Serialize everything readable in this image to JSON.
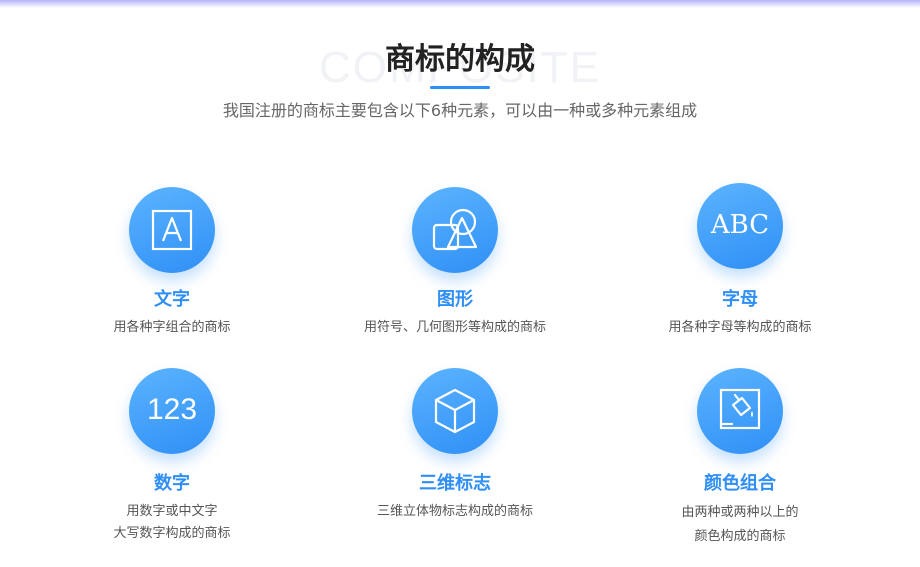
{
  "header": {
    "background_word": "COMPOSITE",
    "title": "商标的构成",
    "subtitle": "我国注册的商标主要包含以下6种元素，可以由一种或多种元素组成"
  },
  "colors": {
    "accent": "#2f8ff5",
    "icon_circle_light": "#5cb4ff",
    "text_dark": "#222222",
    "text_gray": "#666666"
  },
  "elements": [
    {
      "icon": "letter-a-icon",
      "title": "文字",
      "desc": [
        "用各种字组合的商标"
      ]
    },
    {
      "icon": "shapes-icon",
      "title": "图形",
      "desc": [
        "用符号、几何图形等构成的商标"
      ]
    },
    {
      "icon": "abc-icon",
      "icon_text": "ABC",
      "title": "字母",
      "desc": [
        "用各种字母等构成的商标"
      ]
    },
    {
      "icon": "numbers-icon",
      "icon_text": "123",
      "title": "数字",
      "desc": [
        "用数字或中文字",
        "大写数字构成的商标"
      ]
    },
    {
      "icon": "cube-icon",
      "title": "三维标志",
      "desc": [
        "三维立体物标志构成的商标"
      ]
    },
    {
      "icon": "paint-bucket-icon",
      "title": "颜色组合",
      "desc": [
        "由两种或两种以上的",
        "颜色构成的商标"
      ]
    }
  ]
}
